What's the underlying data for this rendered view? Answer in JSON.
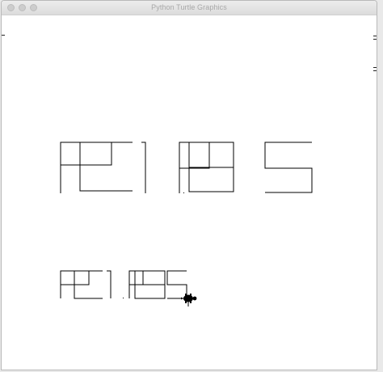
{
  "window": {
    "title": "Python Turtle Graphics"
  },
  "colors": {
    "pen": "#000000",
    "background": "#ffffff",
    "title_text": "#a8a8a8"
  },
  "icons": {
    "close": "close-icon",
    "minimize": "minimize-icon",
    "maximize": "maximize-icon",
    "turtle": "turtle-icon"
  },
  "drawing": {
    "large_text": "PC1985",
    "small_text": "PC1985",
    "dot_between_digits": true
  }
}
